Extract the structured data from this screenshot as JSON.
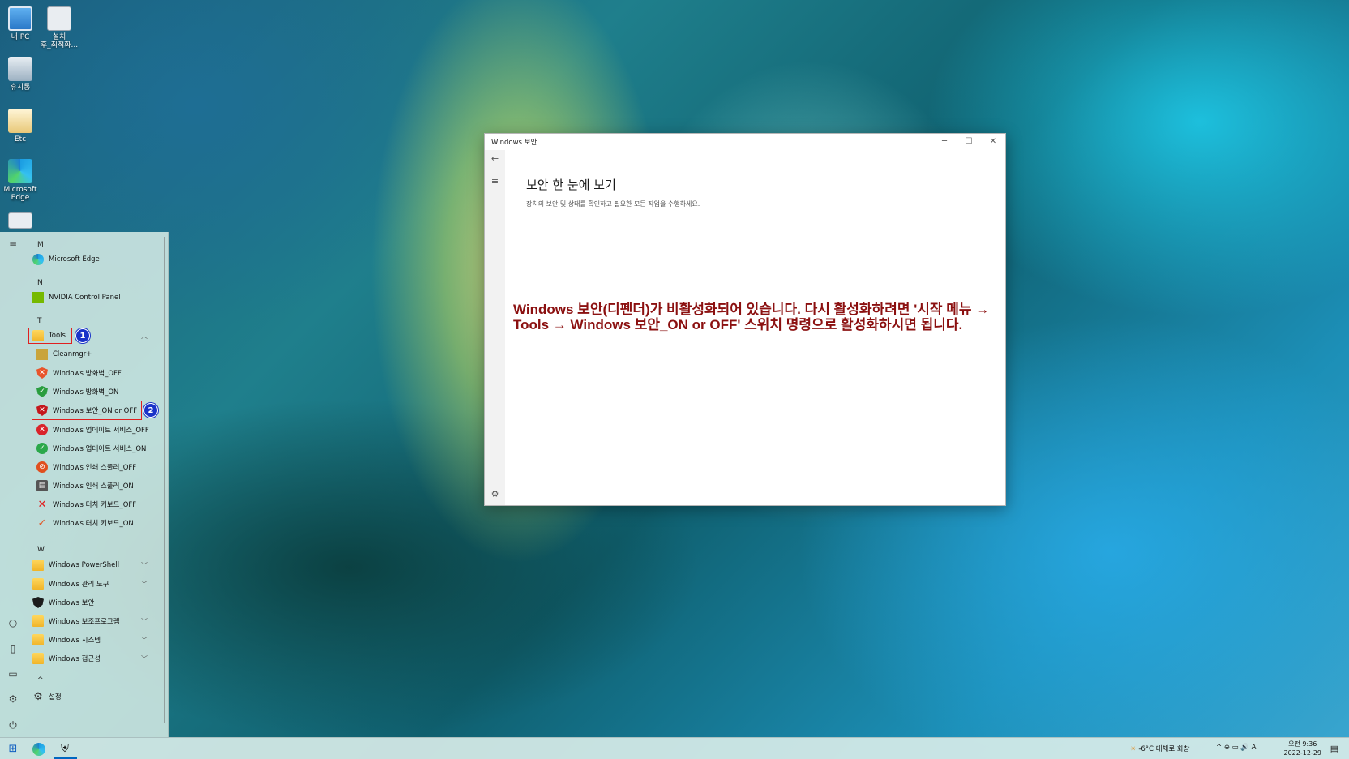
{
  "desktop": {
    "icons": [
      {
        "label": "내 PC",
        "icon": "computer-icon"
      },
      {
        "label": "설치\n후_최적화...",
        "icon": "setup-icon"
      },
      {
        "label": "휴지통",
        "icon": "recycle-bin-icon"
      },
      {
        "label": "Etc",
        "icon": "folder-icon"
      },
      {
        "label": "Microsoft\nEdge",
        "icon": "edge-icon"
      }
    ]
  },
  "start_menu": {
    "letters": {
      "m": "M",
      "n": "N",
      "t": "T",
      "w": "W",
      "caret": "^"
    },
    "items": [
      {
        "label": "Microsoft Edge",
        "icon": "edge-icon"
      },
      {
        "label": "NVIDIA Control Panel",
        "icon": "nvidia-icon"
      },
      {
        "label": "Tools",
        "icon": "folder-icon"
      },
      {
        "label": "Cleanmgr+",
        "icon": "cleanmgr-icon"
      },
      {
        "label": "Windows 방화벽_OFF",
        "icon": "shield-x-icon"
      },
      {
        "label": "Windows 방화벽_ON",
        "icon": "shield-check-icon"
      },
      {
        "label": "Windows 보안_ON or OFF",
        "icon": "shield-x-icon"
      },
      {
        "label": "Windows 업데이트 서비스_OFF",
        "icon": "x-circle-icon"
      },
      {
        "label": "Windows 업데이트 서비스_ON",
        "icon": "check-circle-icon"
      },
      {
        "label": "Windows 인쇄 스풀러_OFF",
        "icon": "disabled-icon"
      },
      {
        "label": "Windows 인쇄 스풀러_ON",
        "icon": "printer-icon"
      },
      {
        "label": "Windows 터치 키보드_OFF",
        "icon": "x-mark-icon"
      },
      {
        "label": "Windows 터치 키보드_ON",
        "icon": "check-mark-icon"
      },
      {
        "label": "Windows PowerShell",
        "icon": "folder-icon"
      },
      {
        "label": "Windows 관리 도구",
        "icon": "folder-icon"
      },
      {
        "label": "Windows 보안",
        "icon": "shield-icon"
      },
      {
        "label": "Windows 보조프로그램",
        "icon": "folder-icon"
      },
      {
        "label": "Windows 시스템",
        "icon": "folder-icon"
      },
      {
        "label": "Windows 접근성",
        "icon": "folder-icon"
      },
      {
        "label": "설정",
        "icon": "gear-icon"
      }
    ],
    "badges": [
      "1",
      "2"
    ],
    "highlight_color": "#e02020",
    "badge_color": "#1a33c8"
  },
  "security_window": {
    "title": "Windows 보안",
    "heading": "보안 한 눈에 보기",
    "subheading": "장치의 보안 및 상태를 확인하고 필요한 모든 작업을 수행하세요.",
    "note": "Windows 보안(디펜더)가 비활성화되어 있습니다. 다시 활성화하려면 '시작 메뉴 → Tools → Windows 보안_ON or OFF' 스위치 명령으로 활성화하시면 됩니다.",
    "note_color": "#8b1010"
  },
  "taskbar": {
    "weather": "-6°C 대체로 화창",
    "tray_glyphs": "^  ⊕  ▭  🔊  A",
    "time": "오전 9:36",
    "date": "2022-12-29",
    "accent": "#0067c0"
  }
}
